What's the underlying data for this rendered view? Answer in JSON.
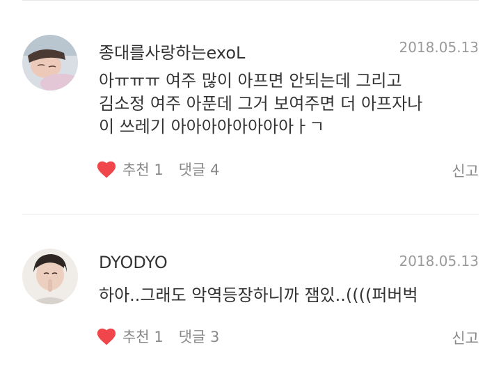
{
  "comments": [
    {
      "username": "종대를사랑하는exoL",
      "date": "2018.05.13",
      "lines": [
        "아ㅠㅠㅠ 여주 많이 아프면 안되는데 그리고",
        "김소정 여주 아푼데 그거 보여주면 더 아프자나",
        "이 쓰레기 아아아아아아아아ㅏㄱ"
      ],
      "like_label": "추천",
      "like_count": "1",
      "reply_label": "댓글",
      "reply_count": "4",
      "report_label": "신고",
      "heart_color": "#f0464b"
    },
    {
      "username": "DYODYO",
      "date": "2018.05.13",
      "lines": [
        "하아..그래도 악역등장하니까 잼있..((((퍼버벅"
      ],
      "like_label": "추천",
      "like_count": "1",
      "reply_label": "댓글",
      "reply_count": "3",
      "report_label": "신고",
      "heart_color": "#f0464b"
    }
  ]
}
